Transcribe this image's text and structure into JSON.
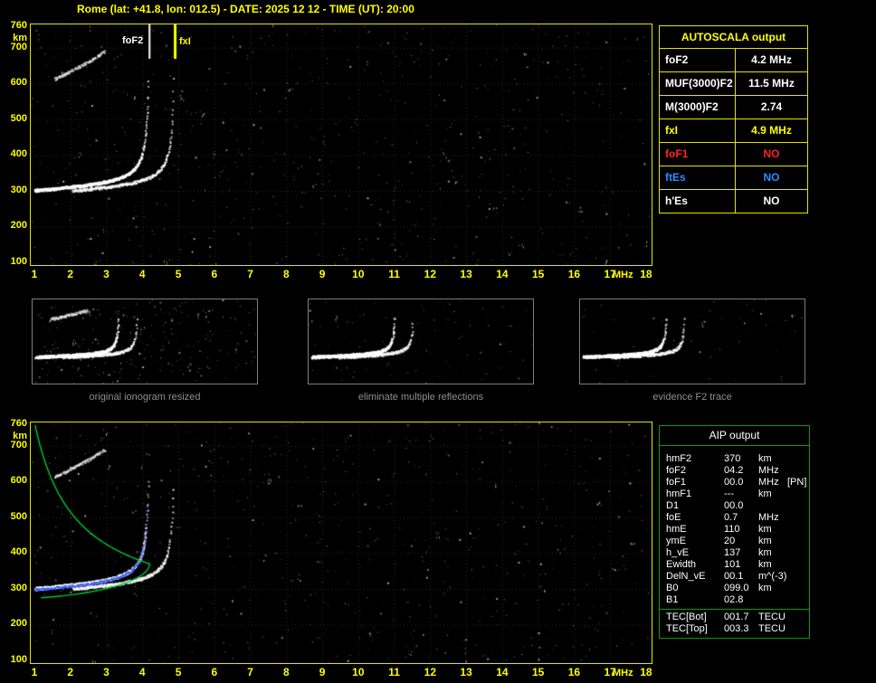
{
  "title": "Rome (lat: +41.8, lon: 012.5) - DATE: 2025 12 12 - TIME (UT): 20:00",
  "colors": {
    "background": "#000000",
    "yellow": "#ffff00",
    "white": "#ffffff",
    "red": "#ff2222",
    "blue": "#2b8cff",
    "green_border": "#00a000",
    "green_line": "#00c832",
    "blue_fit": "#3a5fff",
    "caption_gray": "#8f8f8f"
  },
  "ionogram": {
    "y_unit": "km",
    "x_unit": "MHz",
    "y_ticks": [
      760,
      700,
      600,
      500,
      400,
      300,
      200,
      100
    ],
    "x_ticks": [
      1,
      2,
      3,
      4,
      5,
      6,
      7,
      8,
      9,
      10,
      11,
      12,
      13,
      14,
      15,
      16,
      17,
      18
    ],
    "markers": {
      "foF2_label": "foF2",
      "fxI_label": "fxI"
    }
  },
  "plot": {
    "foF2_mhz": 4.2,
    "fxI_mhz": 4.9,
    "hmF2_km": 370,
    "b0_km": 99
  },
  "autoscala_table": {
    "header": "AUTOSCALA output",
    "rows": [
      {
        "param": "foF2",
        "value": "4.2 MHz",
        "color": "white"
      },
      {
        "param": "MUF(3000)F2",
        "value": "11.5 MHz",
        "color": "white"
      },
      {
        "param": "M(3000)F2",
        "value": "2.74",
        "color": "white"
      },
      {
        "param": "fxI",
        "value": "4.9 MHz",
        "color": "yellow"
      },
      {
        "param": "foF1",
        "value": "NO",
        "color": "red"
      },
      {
        "param": "ftEs",
        "value": "NO",
        "color": "blue"
      },
      {
        "param": "h'Es",
        "value": "NO",
        "color": "white"
      }
    ]
  },
  "thumbnails": [
    {
      "caption": "original ionogram resized"
    },
    {
      "caption": "eliminate multiple reflections"
    },
    {
      "caption": "evidence F2 trace"
    }
  ],
  "aip_table": {
    "header": "AIP output",
    "rows": [
      {
        "param": "hmF2",
        "value": "370",
        "unit": "km",
        "note": ""
      },
      {
        "param": "foF2",
        "value": "04.2",
        "unit": "MHz",
        "note": ""
      },
      {
        "param": "foF1",
        "value": "00.0",
        "unit": "MHz",
        "note": "[PN]"
      },
      {
        "param": "hmF1",
        "value": "---",
        "unit": "km",
        "note": ""
      },
      {
        "param": "D1",
        "value": "00.0",
        "unit": "",
        "note": ""
      },
      {
        "param": "foE",
        "value": "0.7",
        "unit": "MHz",
        "note": ""
      },
      {
        "param": "hmE",
        "value": "110",
        "unit": "km",
        "note": ""
      },
      {
        "param": "ymE",
        "value": "20",
        "unit": "km",
        "note": ""
      },
      {
        "param": "h_vE",
        "value": "137",
        "unit": "km",
        "note": ""
      },
      {
        "param": "Ewidth",
        "value": "101",
        "unit": "km",
        "note": ""
      },
      {
        "param": "DelN_vE",
        "value": "00.1",
        "unit": "m^(-3)",
        "note": ""
      },
      {
        "param": "B0",
        "value": "099.0",
        "unit": "km",
        "note": ""
      },
      {
        "param": "B1",
        "value": "02.8",
        "unit": "",
        "note": ""
      }
    ],
    "tec_rows": [
      {
        "param": "TEC[Bot]",
        "value": "001.7",
        "unit": "TECU",
        "note": ""
      },
      {
        "param": "TEC[Top]",
        "value": "003.3",
        "unit": "TECU",
        "note": ""
      }
    ]
  }
}
